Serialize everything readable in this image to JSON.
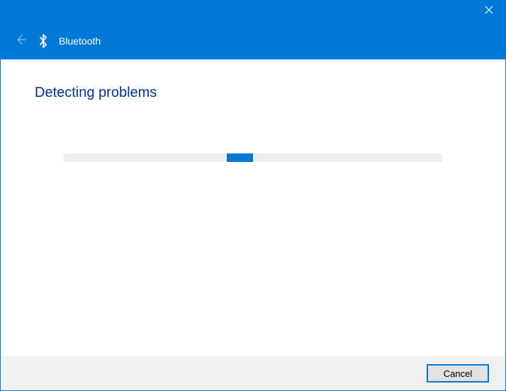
{
  "header": {
    "title": "Bluetooth"
  },
  "main": {
    "heading": "Detecting problems",
    "progress": {
      "left_pct": 43,
      "width_pct": 7
    }
  },
  "footer": {
    "cancel_label": "Cancel"
  }
}
